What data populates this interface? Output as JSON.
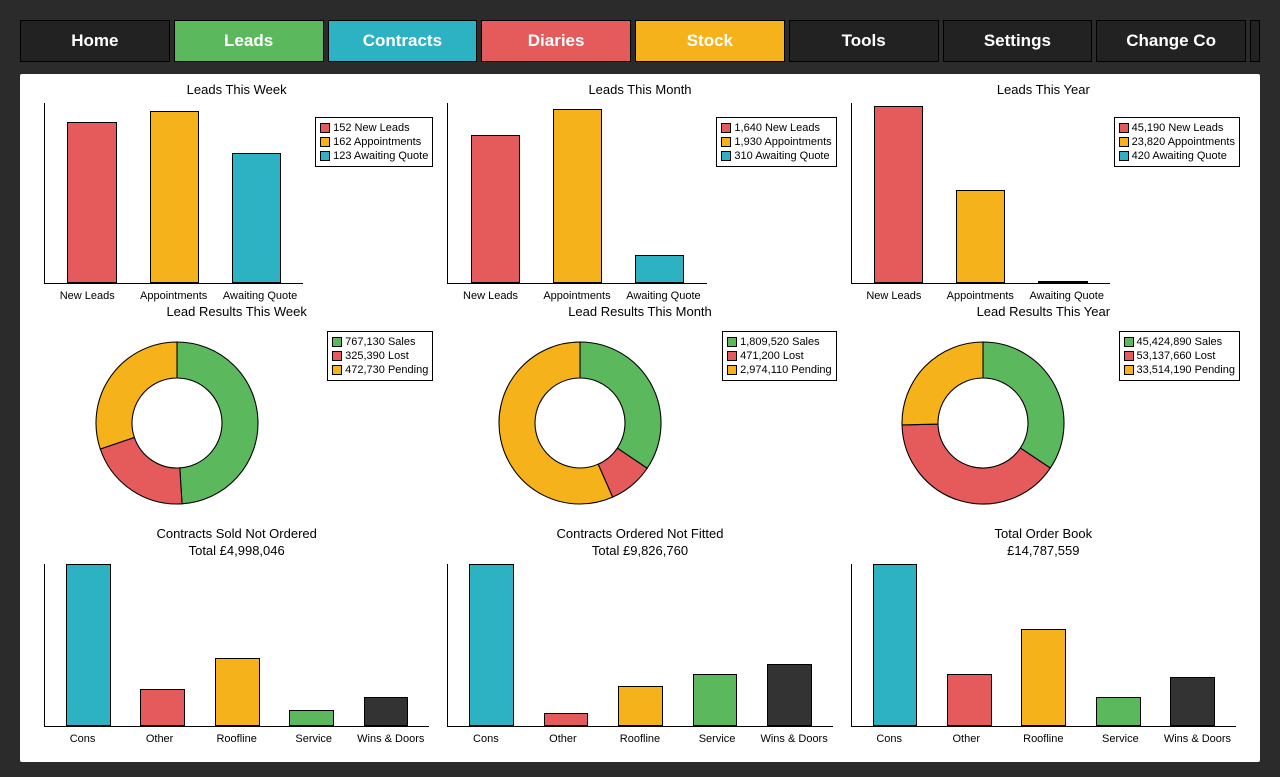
{
  "nav": {
    "home": "Home",
    "leads": "Leads",
    "contracts": "Contracts",
    "diaries": "Diaries",
    "stock": "Stock",
    "tools": "Tools",
    "settings": "Settings",
    "change": "Change Co"
  },
  "colors": {
    "red": "#e55a5a",
    "orange": "#f6b21a",
    "teal": "#2db2c4",
    "green": "#5cb85c",
    "dark": "#333333"
  },
  "chart_data": [
    {
      "id": "leads_week",
      "type": "bar",
      "title": "Leads This Week",
      "categories": [
        "New Leads",
        "Appointments",
        "Awaiting Quote"
      ],
      "values": [
        152,
        162,
        123
      ],
      "colors": [
        "red",
        "orange",
        "teal"
      ],
      "ylim": [
        0,
        170
      ],
      "legend": [
        "152 New Leads",
        "162 Appointments",
        "123 Awaiting Quote"
      ]
    },
    {
      "id": "leads_month",
      "type": "bar",
      "title": "Leads This Month",
      "categories": [
        "New Leads",
        "Appointments",
        "Awaiting Quote"
      ],
      "values": [
        1640,
        1930,
        310
      ],
      "colors": [
        "red",
        "orange",
        "teal"
      ],
      "ylim": [
        0,
        2000
      ],
      "legend": [
        "1,640 New Leads",
        "1,930 Appointments",
        "   310 Awaiting Quote"
      ]
    },
    {
      "id": "leads_year",
      "type": "bar",
      "title": "Leads This Year",
      "categories": [
        "New Leads",
        "Appointments",
        "Awaiting Quote"
      ],
      "values": [
        45190,
        23820,
        420
      ],
      "colors": [
        "red",
        "orange",
        "teal"
      ],
      "ylim": [
        0,
        46000
      ],
      "legend": [
        "45,190 New Leads",
        "23,820 Appointments",
        "     420 Awaiting Quote"
      ]
    },
    {
      "id": "results_week",
      "type": "pie",
      "title": "Lead Results This Week",
      "series": [
        {
          "name": "Sales",
          "value": 767130,
          "color": "green"
        },
        {
          "name": "Lost",
          "value": 325390,
          "color": "red"
        },
        {
          "name": "Pending",
          "value": 472730,
          "color": "orange"
        }
      ],
      "legend": [
        "767,130 Sales",
        "325,390 Lost",
        "472,730 Pending"
      ]
    },
    {
      "id": "results_month",
      "type": "pie",
      "title": "Lead Results This Month",
      "series": [
        {
          "name": "Sales",
          "value": 1809520,
          "color": "green"
        },
        {
          "name": "Lost",
          "value": 471200,
          "color": "red"
        },
        {
          "name": "Pending",
          "value": 2974110,
          "color": "orange"
        }
      ],
      "legend": [
        "1,809,520 Sales",
        "   471,200 Lost",
        "2,974,110 Pending"
      ]
    },
    {
      "id": "results_year",
      "type": "pie",
      "title": "Lead Results This Year",
      "series": [
        {
          "name": "Sales",
          "value": 45424890,
          "color": "green"
        },
        {
          "name": "Lost",
          "value": 53137660,
          "color": "red"
        },
        {
          "name": "Pending",
          "value": 33514190,
          "color": "orange"
        }
      ],
      "legend": [
        "45,424,890 Sales",
        "53,137,660 Lost",
        "33,514,190 Pending"
      ]
    },
    {
      "id": "sold_not_ordered",
      "type": "bar",
      "title": "Contracts Sold Not Ordered",
      "subtitle": "Total £4,998,046",
      "categories": [
        "Cons",
        "Other",
        "Roofline",
        "Service",
        "Wins & Doors"
      ],
      "values": [
        100,
        23,
        42,
        10,
        18
      ],
      "colors": [
        "teal",
        "red",
        "orange",
        "green",
        "dark"
      ],
      "ylim": [
        0,
        100
      ]
    },
    {
      "id": "ordered_not_fitted",
      "type": "bar",
      "title": "Contracts Ordered Not Fitted",
      "subtitle": "Total £9,826,760",
      "categories": [
        "Cons",
        "Other",
        "Roofline",
        "Service",
        "Wins & Doors"
      ],
      "values": [
        100,
        8,
        25,
        32,
        38
      ],
      "colors": [
        "teal",
        "red",
        "orange",
        "green",
        "dark"
      ],
      "ylim": [
        0,
        100
      ]
    },
    {
      "id": "order_book",
      "type": "bar",
      "title": "Total Order Book",
      "subtitle": "£14,787,559",
      "categories": [
        "Cons",
        "Other",
        "Roofline",
        "Service",
        "Wins & Doors"
      ],
      "values": [
        100,
        32,
        60,
        18,
        30
      ],
      "colors": [
        "teal",
        "red",
        "orange",
        "green",
        "dark"
      ],
      "ylim": [
        0,
        100
      ]
    }
  ]
}
